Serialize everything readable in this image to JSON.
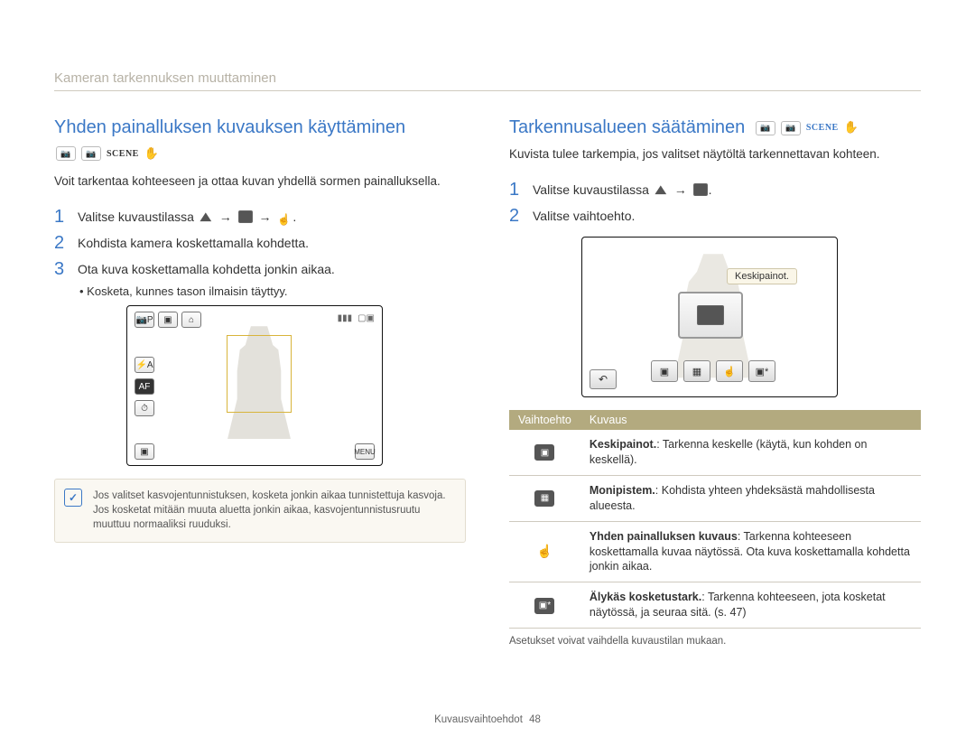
{
  "page_title": "Kameran tarkennuksen muuttaminen",
  "footer": {
    "section": "Kuvausvaihtoehdot",
    "page_number": "48"
  },
  "left": {
    "heading": "Yhden painalluksen kuvauksen käyttäminen",
    "mode_label": "SCENE",
    "intro": "Voit tarkentaa kohteeseen ja ottaa kuvan yhdellä sormen painalluksella.",
    "steps": [
      "Valitse kuvaustilassa",
      "Kohdista kamera koskettamalla kohdetta.",
      "Ota kuva koskettamalla kohdetta jonkin aikaa."
    ],
    "sub_bullet": "Kosketa, kunnes tason ilmaisin täyttyy.",
    "lcd": {
      "af_label": "AF",
      "menu_label": "MENU"
    },
    "note": "Jos valitset kasvojentunnistuksen, kosketa jonkin aikaa tunnistettuja kasvoja. Jos kosketat mitään muuta aluetta jonkin aikaa, kasvojentunnistusruutu muuttuu normaaliksi ruuduksi."
  },
  "right": {
    "heading": "Tarkennusalueen säätäminen",
    "mode_label": "SCENE",
    "intro": "Kuvista tulee tarkempia, jos valitset näytöltä tarkennettavan kohteen.",
    "steps": [
      "Valitse kuvaustilassa",
      "Valitse vaihtoehto."
    ],
    "tooltip": "Keskipainot.",
    "table": {
      "head_option": "Vaihtoehto",
      "head_desc": "Kuvaus",
      "rows": [
        {
          "icon": "center",
          "term": "Keskipainot.",
          "desc": ": Tarkenna keskelle (käytä, kun kohden on keskellä)."
        },
        {
          "icon": "grid",
          "term": "Monipistem.",
          "desc": ": Kohdista yhteen yhdeksästä mahdollisesta alueesta."
        },
        {
          "icon": "touch",
          "term": "Yhden painalluksen kuvaus",
          "desc": ": Tarkenna kohteeseen koskettamalla kuvaa näytössä. Ota kuva koskettamalla kohdetta jonkin aikaa."
        },
        {
          "icon": "smart",
          "term": "Älykäs kosketustark.",
          "desc": ": Tarkenna kohteeseen, jota kosketat näytössä, ja seuraa sitä. (s. 47)"
        }
      ]
    },
    "footnote": "Asetukset voivat vaihdella kuvaustilan mukaan."
  }
}
